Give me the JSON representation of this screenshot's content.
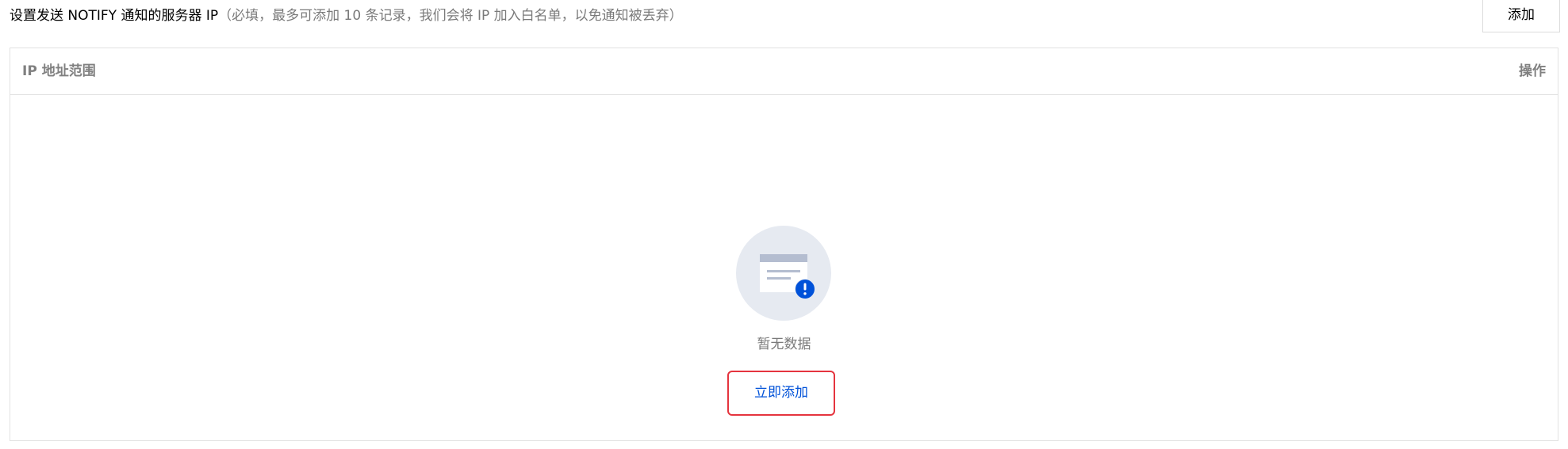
{
  "header": {
    "title": "设置发送 NOTIFY 通知的服务器 IP",
    "hint": "（必填，最多可添加 10 条记录，我们会将 IP 加入白名单，以免通知被丢弃）",
    "add_label": "添加"
  },
  "table": {
    "columns": [
      "IP 地址范围",
      "操作"
    ],
    "rows": []
  },
  "empty_state": {
    "icon": "empty-data-icon",
    "message": "暂无数据",
    "action_label": "立即添加"
  },
  "colors": {
    "accent": "#0052d9",
    "highlight_border": "#e5343e",
    "muted_text": "#7a7a7a",
    "border": "#e2e2e2"
  }
}
